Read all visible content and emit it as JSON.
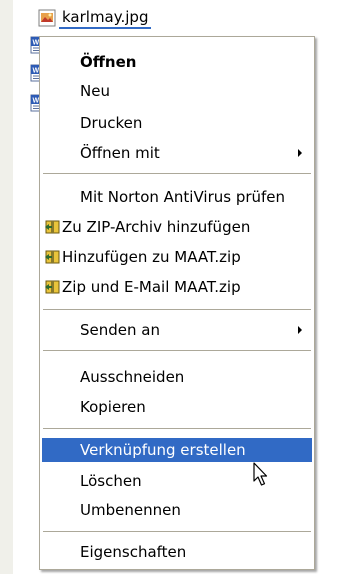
{
  "file": {
    "name": "karlmay.jpg"
  },
  "menu": {
    "open": "Öffnen",
    "new": "Neu",
    "print": "Drucken",
    "open_with": "Öffnen mit",
    "norton": "Mit Norton AntiVirus prüfen",
    "zip_add": "Zu ZIP-Archiv hinzufügen",
    "zip_add_maat": "Hinzufügen zu MAAT.zip",
    "zip_mail": "Zip und E-Mail MAAT.zip",
    "send_to": "Senden an",
    "cut": "Ausschneiden",
    "copy": "Kopieren",
    "create_shortcut": "Verknüpfung erstellen",
    "delete": "Löschen",
    "rename": "Umbenennen",
    "properties": "Eigenschaften"
  },
  "colors": {
    "selection": "#316ac5",
    "menu_border": "#aca899",
    "pane_edge": "#f0f0ea"
  },
  "icons": {
    "file": "jpg-file-icon",
    "docs": "word-document-icon",
    "zip": "winzip-icon",
    "submenu": "submenu-arrow-icon",
    "cursor": "mouse-pointer-icon"
  }
}
